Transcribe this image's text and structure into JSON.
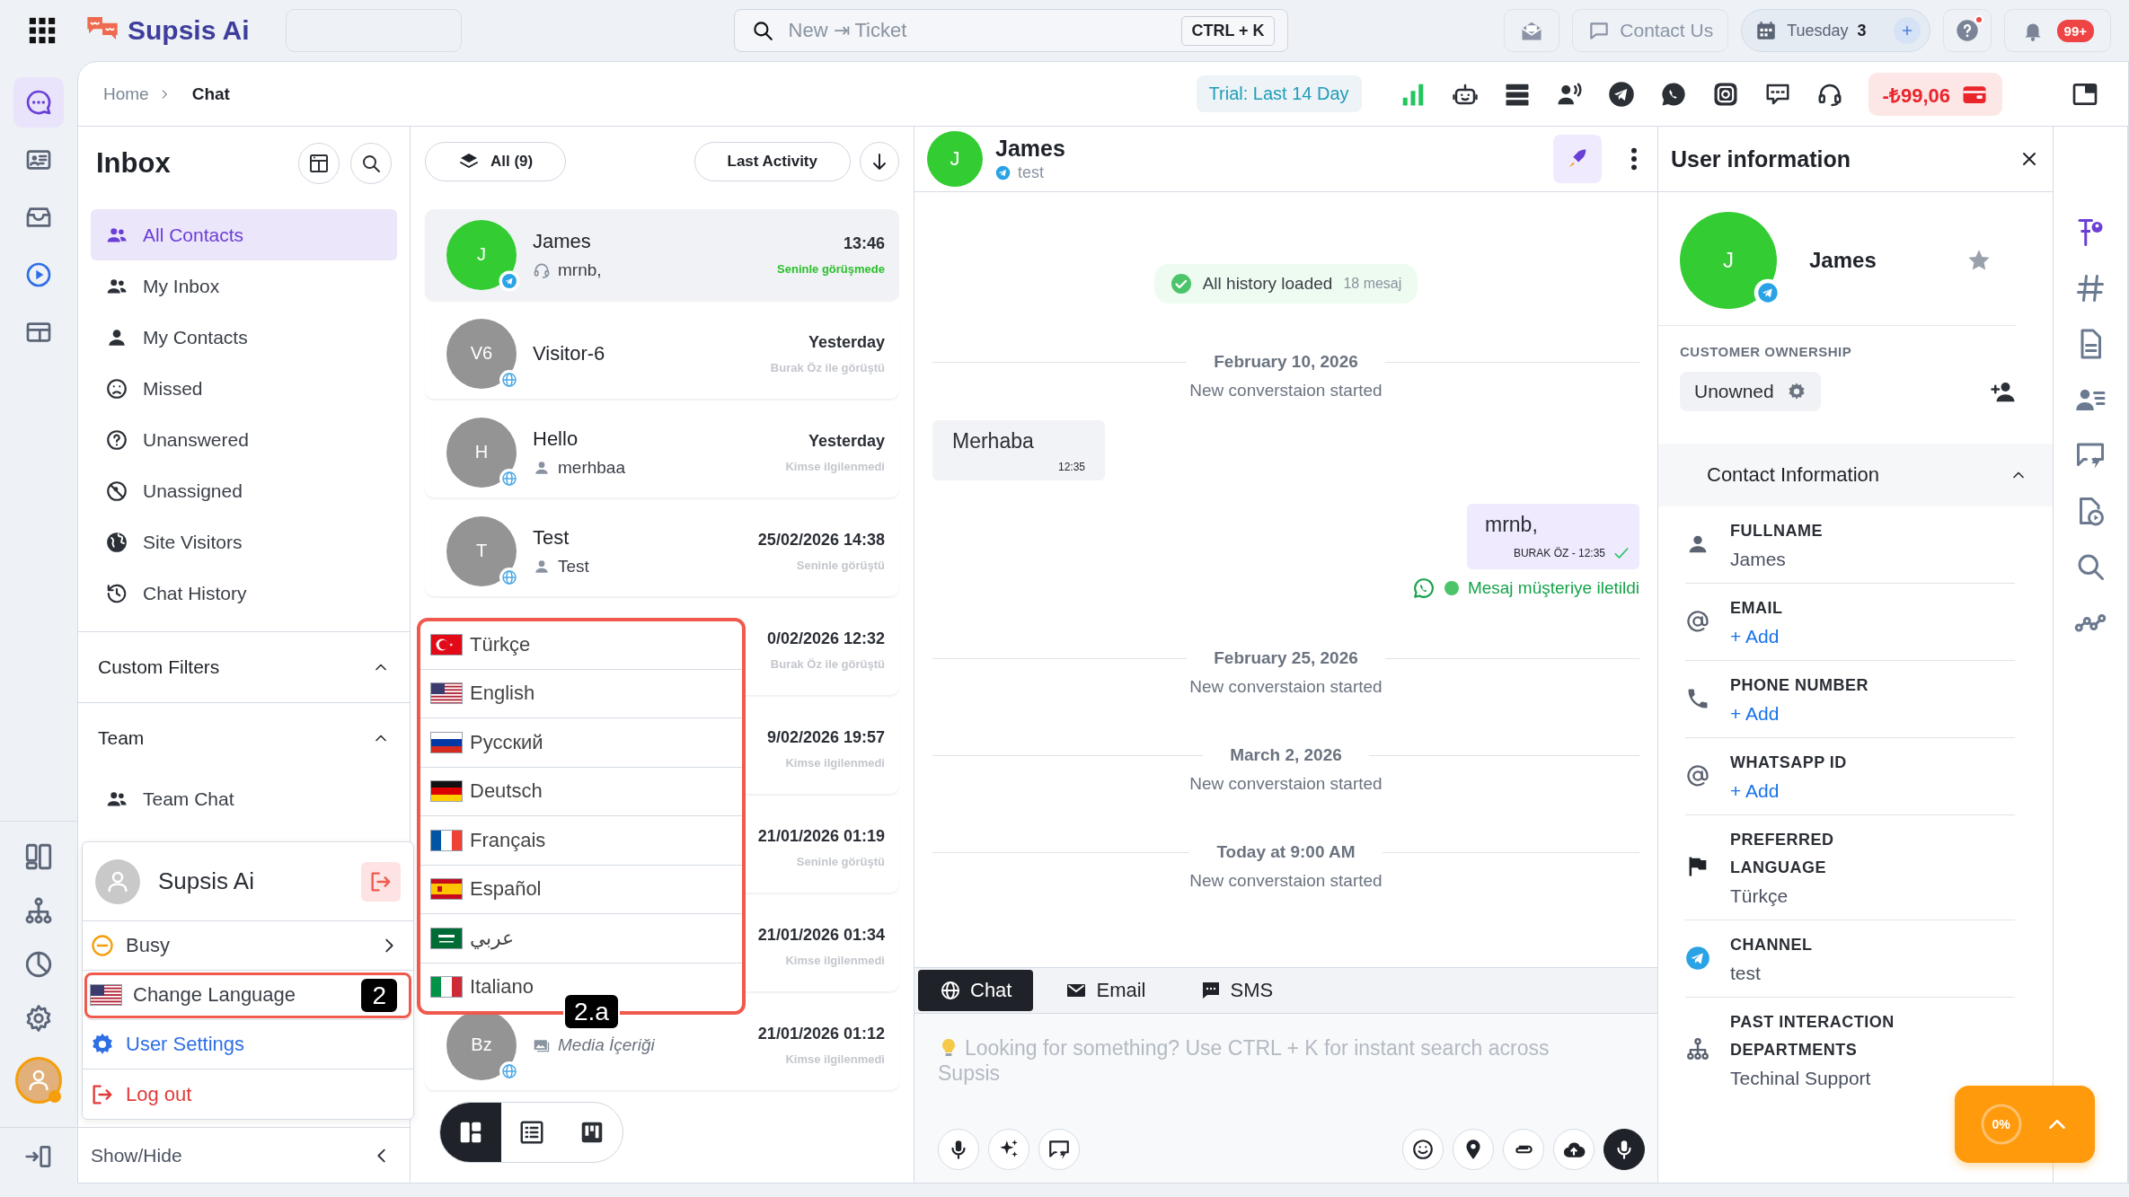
{
  "topbar": {
    "brand": "Supsis Ai",
    "search": {
      "placeholder": "New ⇥ Ticket",
      "shortcut": "CTRL + K"
    },
    "contact_us": "Contact Us",
    "date": {
      "day": "Tuesday",
      "number": "3"
    },
    "help_alert": true,
    "notifications": "99+"
  },
  "rail": [
    {
      "selected": true
    },
    {
      "selected": false
    },
    {
      "selected": false
    },
    {
      "selected": false
    },
    {
      "selected": false
    }
  ],
  "breadcrumb": [
    "Home",
    "Chat"
  ],
  "toolbar": {
    "trial": "Trial: Last 14 Day",
    "balance": "-₺99,06"
  },
  "inbox": {
    "title": "Inbox",
    "filters": [
      {
        "label": "All Contacts",
        "selected": true
      },
      {
        "label": "My Inbox",
        "selected": false
      },
      {
        "label": "My Contacts",
        "selected": false
      },
      {
        "label": "Missed",
        "selected": false
      },
      {
        "label": "Unanswered",
        "selected": false
      },
      {
        "label": "Unassigned",
        "selected": false
      },
      {
        "label": "Site Visitors",
        "selected": false
      },
      {
        "label": "Chat History",
        "selected": false
      }
    ],
    "sections": [
      {
        "title": "Custom Filters",
        "expanded": true
      },
      {
        "title": "Team",
        "expanded": true,
        "items": [
          "Team Chat"
        ]
      }
    ],
    "show_hide": "Show/Hide"
  },
  "contact_list": {
    "filter": "All (9)",
    "sort": "Last Activity",
    "contacts": [
      {
        "initials": "J",
        "badge": {
          "kind": "telegram"
        },
        "name": "James",
        "preview": {
          "kind": "agent",
          "text": "mrnb,"
        },
        "time": "13:46",
        "status": "Seninle görüşmede",
        "ongoing": true,
        "selected": true
      },
      {
        "initials": "V6",
        "badge": {
          "kind": "web"
        },
        "name": "Visitor-6",
        "time": "Yesterday",
        "status": "Burak Öz ile görüştü",
        "ongoing": false,
        "selected": false
      },
      {
        "initials": "H",
        "badge": {
          "kind": "web"
        },
        "name": "Hello",
        "preview": {
          "kind": "contact",
          "text": "merhbaa"
        },
        "time": "Yesterday",
        "status": "Kimse ilgilenmedi",
        "ongoing": false,
        "selected": false
      },
      {
        "initials": "T",
        "badge": {
          "kind": "web"
        },
        "name": "Test",
        "preview": {
          "kind": "contact",
          "text": "Test"
        },
        "time": "25/02/2026 14:38",
        "status": "Seninle görüştü",
        "ongoing": false,
        "selected": false
      },
      {
        "time": "0/02/2026 12:32",
        "status": "Burak Öz ile görüştü",
        "ongoing": false,
        "selected": false
      },
      {
        "time": "9/02/2026 19:57",
        "status": "Kimse ilgilenmedi",
        "ongoing": false,
        "selected": false
      },
      {
        "time": "21/01/2026 01:19",
        "status": "Seninle görüştü",
        "ongoing": false,
        "selected": false
      },
      {
        "time": "21/01/2026 01:34",
        "status": "Kimse ilgilenmedi",
        "ongoing": false,
        "selected": false
      },
      {
        "initials": "Bz",
        "badge": {
          "kind": "web"
        },
        "preview": {
          "kind": "media",
          "text": "Media İçeriği"
        },
        "time": "21/01/2026 01:12",
        "status": "Kimse ilgilenmedi",
        "ongoing": false,
        "selected": false
      }
    ],
    "view_modes": [
      {
        "selected": true
      },
      {
        "selected": false
      },
      {
        "selected": false
      }
    ]
  },
  "chat": {
    "name": "James",
    "initials": "J",
    "channel_label": "test",
    "history": {
      "text": "All history loaded",
      "count": "18 mesaj"
    },
    "events": [
      {
        "kind": "date",
        "text": "February 10, 2026"
      },
      {
        "kind": "note",
        "text": "New converstaion started"
      },
      {
        "kind": "incoming",
        "text": "Merhaba",
        "time": "12:35"
      },
      {
        "kind": "outgoing",
        "text": "mrnb,",
        "meta": "BURAK ÖZ - 12:35"
      },
      {
        "kind": "delivery",
        "text": "Mesaj müşteriye iletildi"
      },
      {
        "kind": "date",
        "text": "February 25, 2026"
      },
      {
        "kind": "note",
        "text": "New converstaion started"
      },
      {
        "kind": "date",
        "text": "March 2, 2026"
      },
      {
        "kind": "note",
        "text": "New converstaion started"
      },
      {
        "kind": "date",
        "text": "Today at 9:00 AM"
      },
      {
        "kind": "note",
        "text": "New converstaion started"
      }
    ],
    "tabs": [
      {
        "label": "Chat",
        "selected": true
      },
      {
        "label": "Email",
        "selected": false
      },
      {
        "label": "SMS",
        "selected": false
      }
    ],
    "composer": {
      "placeholder": "Looking for something? Use CTRL + K for instant search across Supsis"
    }
  },
  "user_info": {
    "title": "User information",
    "name": "James",
    "initials": "J",
    "favorite": false,
    "ownership_label": "CUSTOMER OWNERSHIP",
    "owner": "Unowned",
    "section": {
      "title": "Contact Information",
      "expanded": true
    },
    "fields": [
      {
        "kind": "person",
        "label": "FULLNAME",
        "value": "James"
      },
      {
        "kind": "email",
        "label": "EMAIL",
        "action": "+ Add"
      },
      {
        "kind": "phone",
        "label": "PHONE NUMBER",
        "action": "+ Add"
      },
      {
        "kind": "whatsapp",
        "label": "WHATSAPP ID",
        "action": "+ Add"
      },
      {
        "kind": "language",
        "label": "PREFERRED LANGUAGE",
        "value": "Türkçe"
      },
      {
        "kind": "channel",
        "label": "CHANNEL",
        "value": "test"
      },
      {
        "kind": "department",
        "label": "PAST INTERACTION DEPARTMENTS",
        "value": "Techinal Support"
      }
    ]
  },
  "user_menu": {
    "name": "Supsis Ai",
    "status": "Busy",
    "items": [
      {
        "kind": "language",
        "label": "Change Language",
        "highlighted": true
      },
      {
        "kind": "settings",
        "label": "User Settings",
        "highlighted": false
      },
      {
        "kind": "logout",
        "label": "Log out",
        "highlighted": false
      }
    ]
  },
  "language_menu": [
    {
      "kind": "tr",
      "label": "Türkçe"
    },
    {
      "kind": "us",
      "label": "English"
    },
    {
      "kind": "ru",
      "label": "Русский"
    },
    {
      "kind": "de",
      "label": "Deutsch"
    },
    {
      "kind": "fr",
      "label": "Français"
    },
    {
      "kind": "es",
      "label": "Español"
    },
    {
      "kind": "sa",
      "label": "عربي"
    },
    {
      "kind": "it",
      "label": "Italiano"
    }
  ],
  "callouts": [
    "2",
    "2.a"
  ],
  "progress": {
    "reading": "0%"
  }
}
